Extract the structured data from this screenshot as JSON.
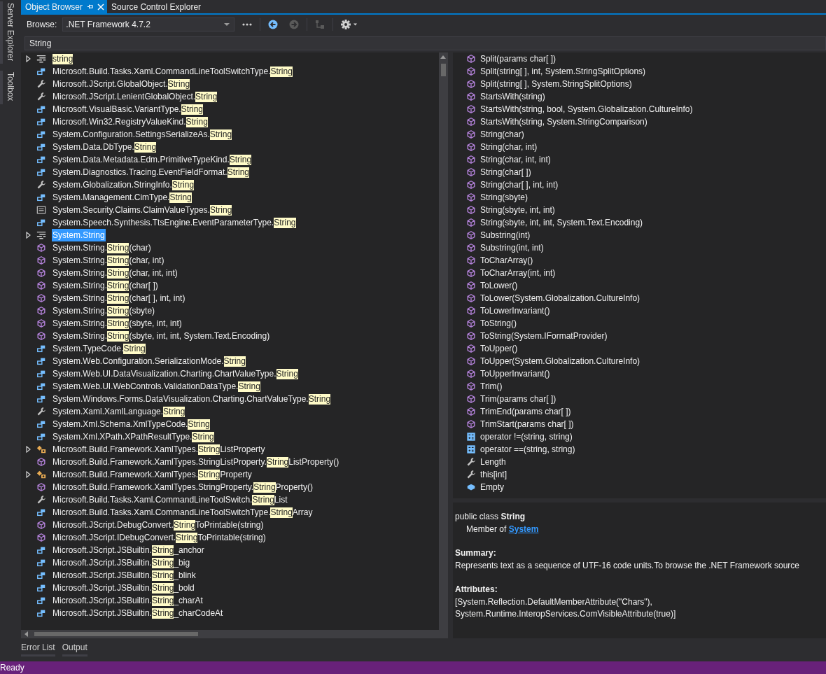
{
  "side_tabs": [
    "Server Explorer",
    "Toolbox"
  ],
  "tabs": [
    {
      "label": "Object Browser",
      "selected": true
    },
    {
      "label": "Source Control Explorer",
      "selected": false
    }
  ],
  "toolbar": {
    "browse_label": "Browse:",
    "browse_value": ".NET Framework 4.7.2",
    "buttons": [
      {
        "kind": "more",
        "disabled": false
      },
      {
        "kind": "back",
        "disabled": false
      },
      {
        "kind": "forward",
        "disabled": true
      },
      {
        "kind": "hierarchy",
        "disabled": true
      },
      {
        "kind": "settings",
        "disabled": false
      }
    ]
  },
  "search": {
    "value": "String"
  },
  "results": [
    {
      "kind": "class_alias",
      "expanded": false,
      "selected": false,
      "match": "string"
    },
    {
      "kind": "enum_member",
      "selected": false,
      "before": "Microsoft.Build.Tasks.Xaml.CommandLineToolSwitchType.",
      "match": "String"
    },
    {
      "kind": "property",
      "selected": false,
      "before": "Microsoft.JScript.GlobalObject.",
      "match": "String"
    },
    {
      "kind": "property",
      "selected": false,
      "before": "Microsoft.JScript.LenientGlobalObject.",
      "match": "String"
    },
    {
      "kind": "enum_member",
      "selected": false,
      "before": "Microsoft.VisualBasic.VariantType.",
      "match": "String"
    },
    {
      "kind": "enum_member",
      "selected": false,
      "before": "Microsoft.Win32.RegistryValueKind.",
      "match": "String"
    },
    {
      "kind": "enum_member",
      "selected": false,
      "before": "System.Configuration.SettingsSerializeAs.",
      "match": "String"
    },
    {
      "kind": "enum_member",
      "selected": false,
      "before": "System.Data.DbType.",
      "match": "String"
    },
    {
      "kind": "enum_member",
      "selected": false,
      "before": "System.Data.Metadata.Edm.PrimitiveTypeKind.",
      "match": "String"
    },
    {
      "kind": "enum_member",
      "selected": false,
      "before": "System.Diagnostics.Tracing.EventFieldFormat.",
      "match": "String"
    },
    {
      "kind": "property",
      "selected": false,
      "before": "System.Globalization.StringInfo.",
      "match": "String"
    },
    {
      "kind": "enum_member",
      "selected": false,
      "before": "System.Management.CimType.",
      "match": "String"
    },
    {
      "kind": "constant",
      "selected": false,
      "before": "System.Security.Claims.ClaimValueTypes.",
      "match": "String"
    },
    {
      "kind": "enum_member",
      "selected": false,
      "before": "System.Speech.Synthesis.TtsEngine.EventParameterType.",
      "match": "String"
    },
    {
      "kind": "class_alias",
      "expanded": false,
      "selected": true,
      "before": "System.String"
    },
    {
      "kind": "method",
      "selected": false,
      "before": "System.String.",
      "match": "String",
      "after": "(char)"
    },
    {
      "kind": "method",
      "selected": false,
      "before": "System.String.",
      "match": "String",
      "after": "(char, int)"
    },
    {
      "kind": "method",
      "selected": false,
      "before": "System.String.",
      "match": "String",
      "after": "(char, int, int)"
    },
    {
      "kind": "method",
      "selected": false,
      "before": "System.String.",
      "match": "String",
      "after": "(char[ ])"
    },
    {
      "kind": "method",
      "selected": false,
      "before": "System.String.",
      "match": "String",
      "after": "(char[ ], int, int)"
    },
    {
      "kind": "method",
      "selected": false,
      "before": "System.String.",
      "match": "String",
      "after": "(sbyte)"
    },
    {
      "kind": "method",
      "selected": false,
      "before": "System.String.",
      "match": "String",
      "after": "(sbyte, int, int)"
    },
    {
      "kind": "method",
      "selected": false,
      "before": "System.String.",
      "match": "String",
      "after": "(sbyte, int, int, System.Text.Encoding)"
    },
    {
      "kind": "enum_member",
      "selected": false,
      "before": "System.TypeCode.",
      "match": "String"
    },
    {
      "kind": "enum_member",
      "selected": false,
      "before": "System.Web.Configuration.SerializationMode.",
      "match": "String"
    },
    {
      "kind": "enum_member",
      "selected": false,
      "before": "System.Web.UI.DataVisualization.Charting.ChartValueType.",
      "match": "String"
    },
    {
      "kind": "enum_member",
      "selected": false,
      "before": "System.Web.UI.WebControls.ValidationDataType.",
      "match": "String"
    },
    {
      "kind": "enum_member",
      "selected": false,
      "before": "System.Windows.Forms.DataVisualization.Charting.ChartValueType.",
      "match": "String"
    },
    {
      "kind": "property",
      "selected": false,
      "before": "System.Xaml.XamlLanguage.",
      "match": "String"
    },
    {
      "kind": "enum_member",
      "selected": false,
      "before": "System.Xml.Schema.XmlTypeCode.",
      "match": "String"
    },
    {
      "kind": "enum_member",
      "selected": false,
      "before": "System.Xml.XPath.XPathResultType.",
      "match": "String"
    },
    {
      "kind": "class",
      "expanded": false,
      "selected": false,
      "before": "Microsoft.Build.Framework.XamlTypes.",
      "match": "String",
      "after": "ListProperty"
    },
    {
      "kind": "method",
      "selected": false,
      "before": "Microsoft.Build.Framework.XamlTypes.StringListProperty.",
      "match": "String",
      "after": "ListProperty()"
    },
    {
      "kind": "class",
      "expanded": false,
      "selected": false,
      "before": "Microsoft.Build.Framework.XamlTypes.",
      "match": "String",
      "after": "Property"
    },
    {
      "kind": "method",
      "selected": false,
      "before": "Microsoft.Build.Framework.XamlTypes.StringProperty.",
      "match": "String",
      "after": "Property()"
    },
    {
      "kind": "property",
      "selected": false,
      "before": "Microsoft.Build.Tasks.Xaml.CommandLineToolSwitch.",
      "match": "String",
      "after": "List"
    },
    {
      "kind": "enum_member",
      "selected": false,
      "before": "Microsoft.Build.Tasks.Xaml.CommandLineToolSwitchType.",
      "match": "String",
      "after": "Array"
    },
    {
      "kind": "method",
      "selected": false,
      "before": "Microsoft.JScript.DebugConvert.",
      "match": "String",
      "after": "ToPrintable(string)"
    },
    {
      "kind": "method",
      "selected": false,
      "before": "Microsoft.JScript.IDebugConvert.",
      "match": "String",
      "after": "ToPrintable(string)"
    },
    {
      "kind": "enum_member",
      "selected": false,
      "before": "Microsoft.JScript.JSBuiltin.",
      "match": "String",
      "after": "_anchor"
    },
    {
      "kind": "enum_member",
      "selected": false,
      "before": "Microsoft.JScript.JSBuiltin.",
      "match": "String",
      "after": "_big"
    },
    {
      "kind": "enum_member",
      "selected": false,
      "before": "Microsoft.JScript.JSBuiltin.",
      "match": "String",
      "after": "_blink"
    },
    {
      "kind": "enum_member",
      "selected": false,
      "before": "Microsoft.JScript.JSBuiltin.",
      "match": "String",
      "after": "_bold"
    },
    {
      "kind": "enum_member",
      "selected": false,
      "before": "Microsoft.JScript.JSBuiltin.",
      "match": "String",
      "after": "_charAt"
    },
    {
      "kind": "enum_member",
      "selected": false,
      "before": "Microsoft.JScript.JSBuiltin.",
      "match": "String",
      "after": "_charCodeAt"
    }
  ],
  "members": [
    {
      "kind": "method",
      "text": "Split(params char[ ])"
    },
    {
      "kind": "method",
      "text": "Split(string[ ], int, System.StringSplitOptions)"
    },
    {
      "kind": "method",
      "text": "Split(string[ ], System.StringSplitOptions)"
    },
    {
      "kind": "method",
      "text": "StartsWith(string)"
    },
    {
      "kind": "method",
      "text": "StartsWith(string, bool, System.Globalization.CultureInfo)"
    },
    {
      "kind": "method",
      "text": "StartsWith(string, System.StringComparison)"
    },
    {
      "kind": "method",
      "text": "String(char)"
    },
    {
      "kind": "method",
      "text": "String(char, int)"
    },
    {
      "kind": "method",
      "text": "String(char, int, int)"
    },
    {
      "kind": "method",
      "text": "String(char[ ])"
    },
    {
      "kind": "method",
      "text": "String(char[ ], int, int)"
    },
    {
      "kind": "method",
      "text": "String(sbyte)"
    },
    {
      "kind": "method",
      "text": "String(sbyte, int, int)"
    },
    {
      "kind": "method",
      "text": "String(sbyte, int, int, System.Text.Encoding)"
    },
    {
      "kind": "method",
      "text": "Substring(int)"
    },
    {
      "kind": "method",
      "text": "Substring(int, int)"
    },
    {
      "kind": "method",
      "text": "ToCharArray()"
    },
    {
      "kind": "method",
      "text": "ToCharArray(int, int)"
    },
    {
      "kind": "method",
      "text": "ToLower()"
    },
    {
      "kind": "method",
      "text": "ToLower(System.Globalization.CultureInfo)"
    },
    {
      "kind": "method",
      "text": "ToLowerInvariant()"
    },
    {
      "kind": "method",
      "text": "ToString()"
    },
    {
      "kind": "method",
      "text": "ToString(System.IFormatProvider)"
    },
    {
      "kind": "method",
      "text": "ToUpper()"
    },
    {
      "kind": "method",
      "text": "ToUpper(System.Globalization.CultureInfo)"
    },
    {
      "kind": "method",
      "text": "ToUpperInvariant()"
    },
    {
      "kind": "method",
      "text": "Trim()"
    },
    {
      "kind": "method",
      "text": "Trim(params char[ ])"
    },
    {
      "kind": "method",
      "text": "TrimEnd(params char[ ])"
    },
    {
      "kind": "method",
      "text": "TrimStart(params char[ ])"
    },
    {
      "kind": "operator",
      "text": "operator !=(string, string)"
    },
    {
      "kind": "operator",
      "text": "operator ==(string, string)"
    },
    {
      "kind": "property",
      "text": "Length"
    },
    {
      "kind": "property",
      "text": "this[int]"
    },
    {
      "kind": "field",
      "text": "Empty"
    }
  ],
  "description": {
    "signature": "public class **String**",
    "member_of_label": "Member of",
    "member_of_link": "System",
    "summary_heading": "Summary:",
    "summary": "Represents text as a sequence of UTF-16 code units.To browse the .NET Framework source",
    "attributes_heading": "Attributes:",
    "attributes": [
      "[System.Reflection.DefaultMemberAttribute(\"Chars\"),",
      "System.Runtime.InteropServices.ComVisibleAttribute(true)]"
    ]
  },
  "bottom_tabs": [
    "Error List",
    "Output"
  ],
  "status_bar": "Ready"
}
